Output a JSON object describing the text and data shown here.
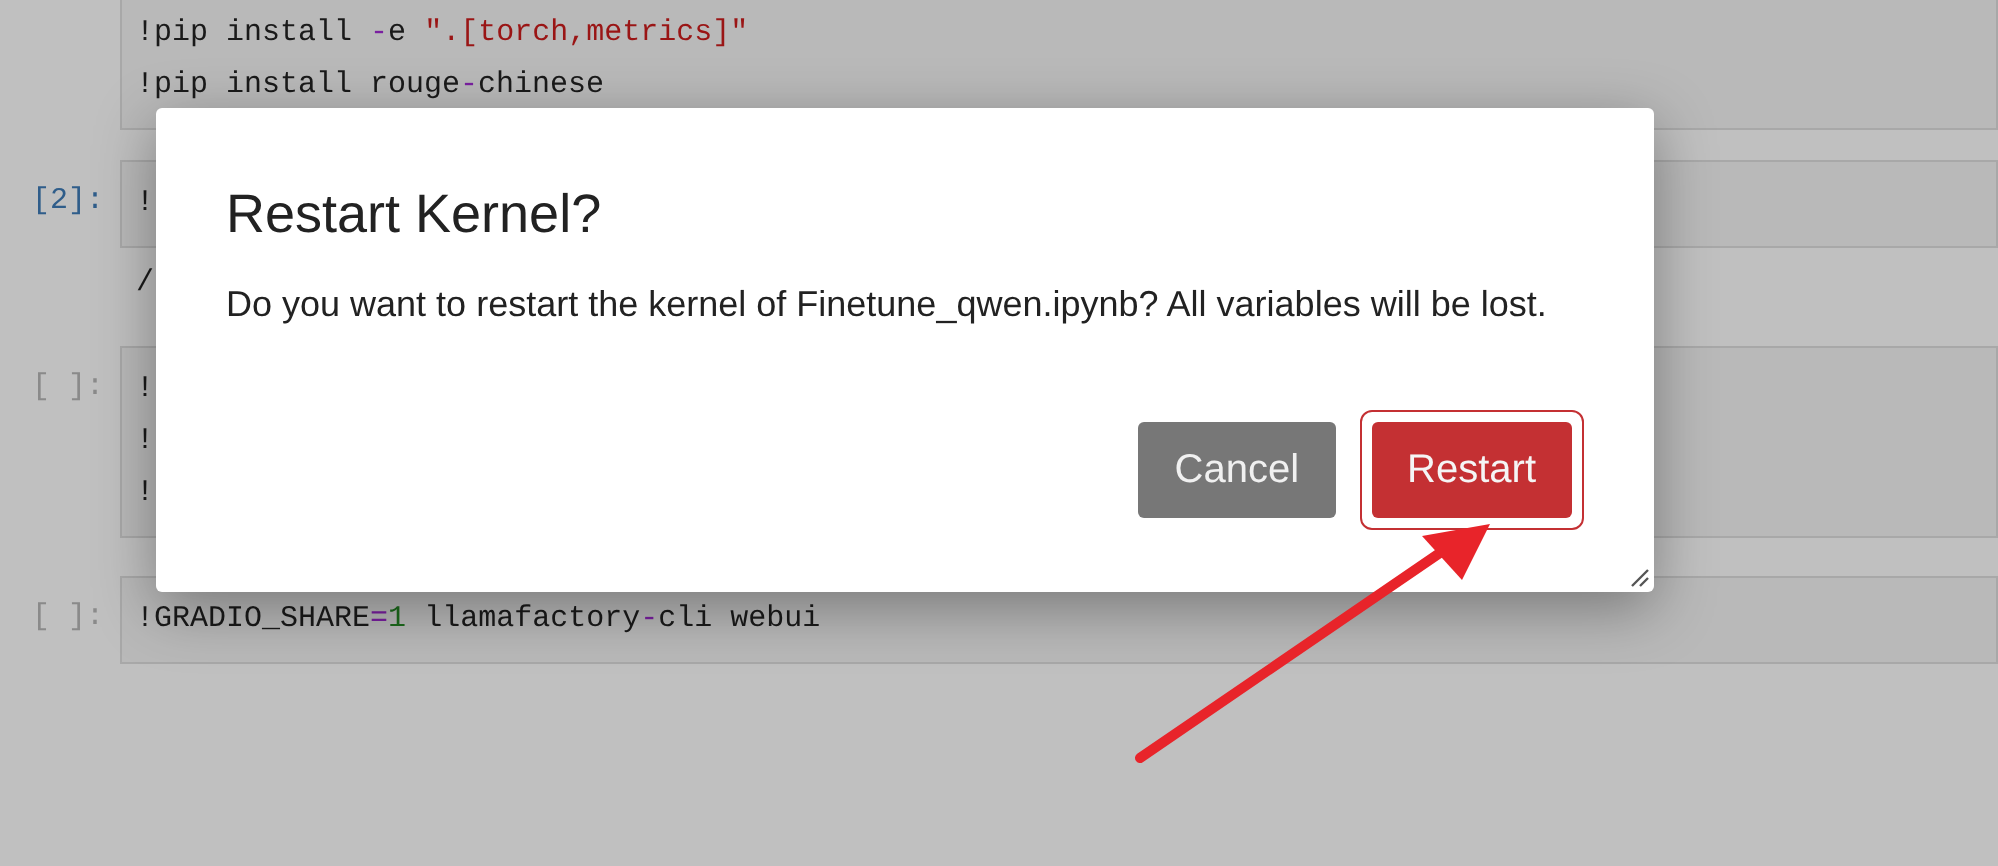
{
  "cells": [
    {
      "lines": [
        [
          {
            "kind": "plain",
            "text": "!pip install "
          },
          {
            "kind": "operator",
            "text": "-"
          },
          {
            "kind": "plain",
            "text": "e "
          },
          {
            "kind": "string",
            "text": "\".[torch,metrics]\""
          }
        ],
        [
          {
            "kind": "plain",
            "text": "!pip install rouge"
          },
          {
            "kind": "operator",
            "text": "-"
          },
          {
            "kind": "plain",
            "text": "chinese"
          }
        ]
      ]
    },
    {
      "prompt": "[2]:",
      "lines": [
        [
          {
            "kind": "plain",
            "text": "!"
          }
        ]
      ],
      "output": "/"
    },
    {
      "prompt": "[ ]:",
      "lines": [
        [
          {
            "kind": "plain",
            "text": "!"
          }
        ],
        [
          {
            "kind": "plain",
            "text": "!"
          }
        ],
        [
          {
            "kind": "plain",
            "text": "!"
          }
        ]
      ]
    },
    {
      "prompt": "[ ]:",
      "lines": [
        [
          {
            "kind": "plain",
            "text": "!GRADIO_SHARE"
          },
          {
            "kind": "operator",
            "text": "="
          },
          {
            "kind": "number",
            "text": "1"
          },
          {
            "kind": "plain",
            "text": " llamafactory"
          },
          {
            "kind": "operator",
            "text": "-"
          },
          {
            "kind": "plain",
            "text": "cli webui"
          }
        ]
      ]
    }
  ],
  "dialog": {
    "title": "Restart Kernel?",
    "message": "Do you want to restart the kernel of Finetune_qwen.ipynb? All variables will be lost.",
    "buttons": [
      {
        "label": "Cancel",
        "kind": "secondary",
        "focused": false
      },
      {
        "label": "Restart",
        "kind": "danger",
        "focused": true
      }
    ]
  }
}
